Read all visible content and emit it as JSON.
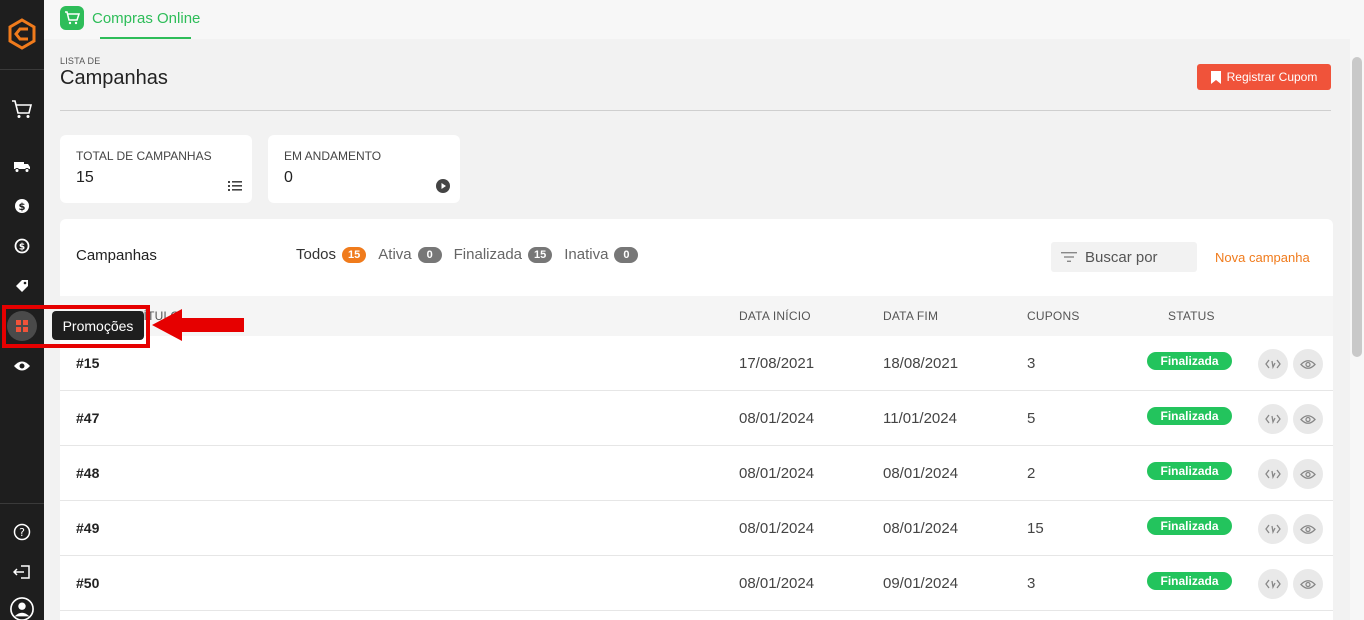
{
  "sidebar": {
    "logo": "brand-logo",
    "tooltip": "Promoções",
    "accent": "#f07b1c"
  },
  "topbar": {
    "tab_label": "Compras Online",
    "tab_color": "#2ebd59"
  },
  "header": {
    "pre_title": "LISTA DE",
    "title": "Campanhas",
    "register_button": "Registrar Cupom",
    "register_color": "#f0533a"
  },
  "stats": [
    {
      "label": "TOTAL DE CAMPANHAS",
      "value": "15",
      "icon": "list-icon"
    },
    {
      "label": "EM ANDAMENTO",
      "value": "0",
      "icon": "play-icon"
    }
  ],
  "panel": {
    "title": "Campanhas",
    "filters": [
      {
        "label": "Todos",
        "count": "15"
      },
      {
        "label": "Ativa",
        "count": "0"
      },
      {
        "label": "Finalizada",
        "count": "15"
      },
      {
        "label": "Inativa",
        "count": "0"
      }
    ],
    "search_placeholder": "Buscar por",
    "new_link": "Nova campanha"
  },
  "table": {
    "columns": [
      "TÍTULO",
      "DATA INÍCIO",
      "DATA FIM",
      "CUPONS",
      "STATUS"
    ],
    "rows": [
      {
        "title": "#15",
        "start": "17/08/2021",
        "end": "18/08/2021",
        "coupons": "3",
        "status": "Finalizada"
      },
      {
        "title": "#47",
        "start": "08/01/2024",
        "end": "11/01/2024",
        "coupons": "5",
        "status": "Finalizada"
      },
      {
        "title": "#48",
        "start": "08/01/2024",
        "end": "08/01/2024",
        "coupons": "2",
        "status": "Finalizada"
      },
      {
        "title": "#49",
        "start": "08/01/2024",
        "end": "08/01/2024",
        "coupons": "15",
        "status": "Finalizada"
      },
      {
        "title": "#50",
        "start": "08/01/2024",
        "end": "09/01/2024",
        "coupons": "3",
        "status": "Finalizada"
      }
    ]
  },
  "status_color": "#23c45d"
}
